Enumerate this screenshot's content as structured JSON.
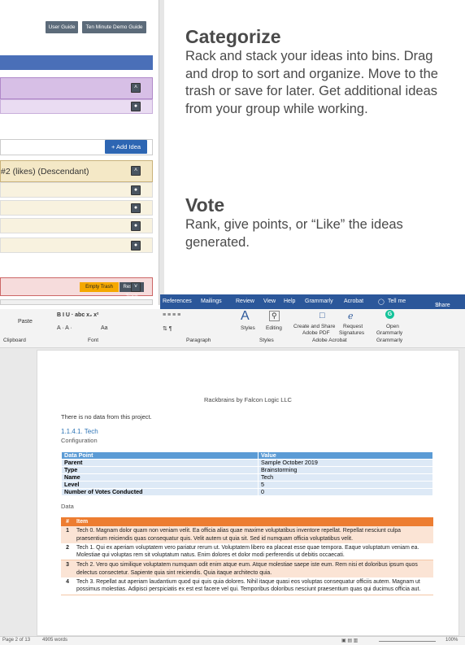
{
  "app": {
    "user_guide": "User Guide",
    "demo_guide": "Ten Minute Demo Guide",
    "add_idea": "Add Idea",
    "sort_label": "#2 (likes) (Descendant)",
    "empty_trash": "Empty Trash",
    "restore_trash": "Restore Trash"
  },
  "panel": {
    "categorize_title": "Categorize",
    "categorize_text": "Rack and stack your ideas into bins. Drag and drop to sort and organize. Move to the trash or save for later. Get additional ideas from your group while working.",
    "vote_title": "Vote",
    "vote_text": "Rank, give points, or “Like” the ideas generated."
  },
  "word": {
    "tabs": [
      "References",
      "Mailings",
      "Review",
      "View",
      "Help",
      "Grammarly",
      "Acrobat"
    ],
    "tell_me": "Tell me",
    "share": "Share",
    "paste": "Paste",
    "group_clipboard": "Clipboard",
    "group_font": "Font",
    "group_paragraph": "Paragraph",
    "group_styles": "Styles",
    "group_adobe": "Adobe Acrobat",
    "group_grammarly": "Grammarly",
    "styles_btn": "Styles",
    "editing_btn": "Editing",
    "create_share_1": "Create and Share",
    "create_share_2": "Adobe PDF",
    "request_sig_1": "Request",
    "request_sig_2": "Signatures",
    "open_grammarly_1": "Open",
    "open_grammarly_2": "Grammarly",
    "font_sample": "Aa",
    "status_page": "Page 2 of 13",
    "status_words": "4905 words",
    "zoom": "100%"
  },
  "doc": {
    "header": "Rackbrains by Falcon Logic LLC",
    "no_data": "There is no data from this project.",
    "section": "1.1.4.1. Tech",
    "config_label": "Configuration",
    "config_head": [
      "Data Point",
      "Value"
    ],
    "config_rows": [
      [
        "Parent",
        "Sample October 2019"
      ],
      [
        "Type",
        "Brainstorming"
      ],
      [
        "Name",
        "Tech"
      ],
      [
        "Level",
        "5"
      ],
      [
        "Number of Votes Conducted",
        "0"
      ]
    ],
    "data_label": "Data",
    "data_head": [
      "#",
      "Item"
    ],
    "data_rows": [
      [
        "1",
        "Tech 0. Magnam dolor quam non veniam velit. Ea officia alias quae maxime voluptatibus inventore repellat. Repellat nesciunt culpa praesentium reiciendis quas consequatur quis. Velit autem ut quia sit. Sed id numquam officia voluptatibus velit."
      ],
      [
        "2",
        "Tech 1. Qui ex aperiam voluptatem vero pariatur rerum ut. Voluptatem libero ea placeat esse quae tempora. Eaque voluptatum veniam ea. Molestiae qui voluptas rem sit voluptatum natus. Enim dolores et dolor modi perferendis ut debitis occaecati."
      ],
      [
        "3",
        "Tech 2. Vero quo similique voluptatem numquam odit enim atque eum. Atque molestiae saepe iste eum. Rem nisi et doloribus ipsum quos delectus consectetur. Sapiente quia sint reiciendis. Quia itaque architecto quia."
      ],
      [
        "4",
        "Tech 3. Repellat aut aperiam laudantium quod qui quis quia dolores. Nihil itaque quasi eos voluptas consequatur officiis autem. Magnam ut possimus molestias. Adipisci perspiciatis ex est est facere vel qui. Temporibus doloribus nesciunt praesentium quas qui ducimus officia aut."
      ]
    ]
  }
}
